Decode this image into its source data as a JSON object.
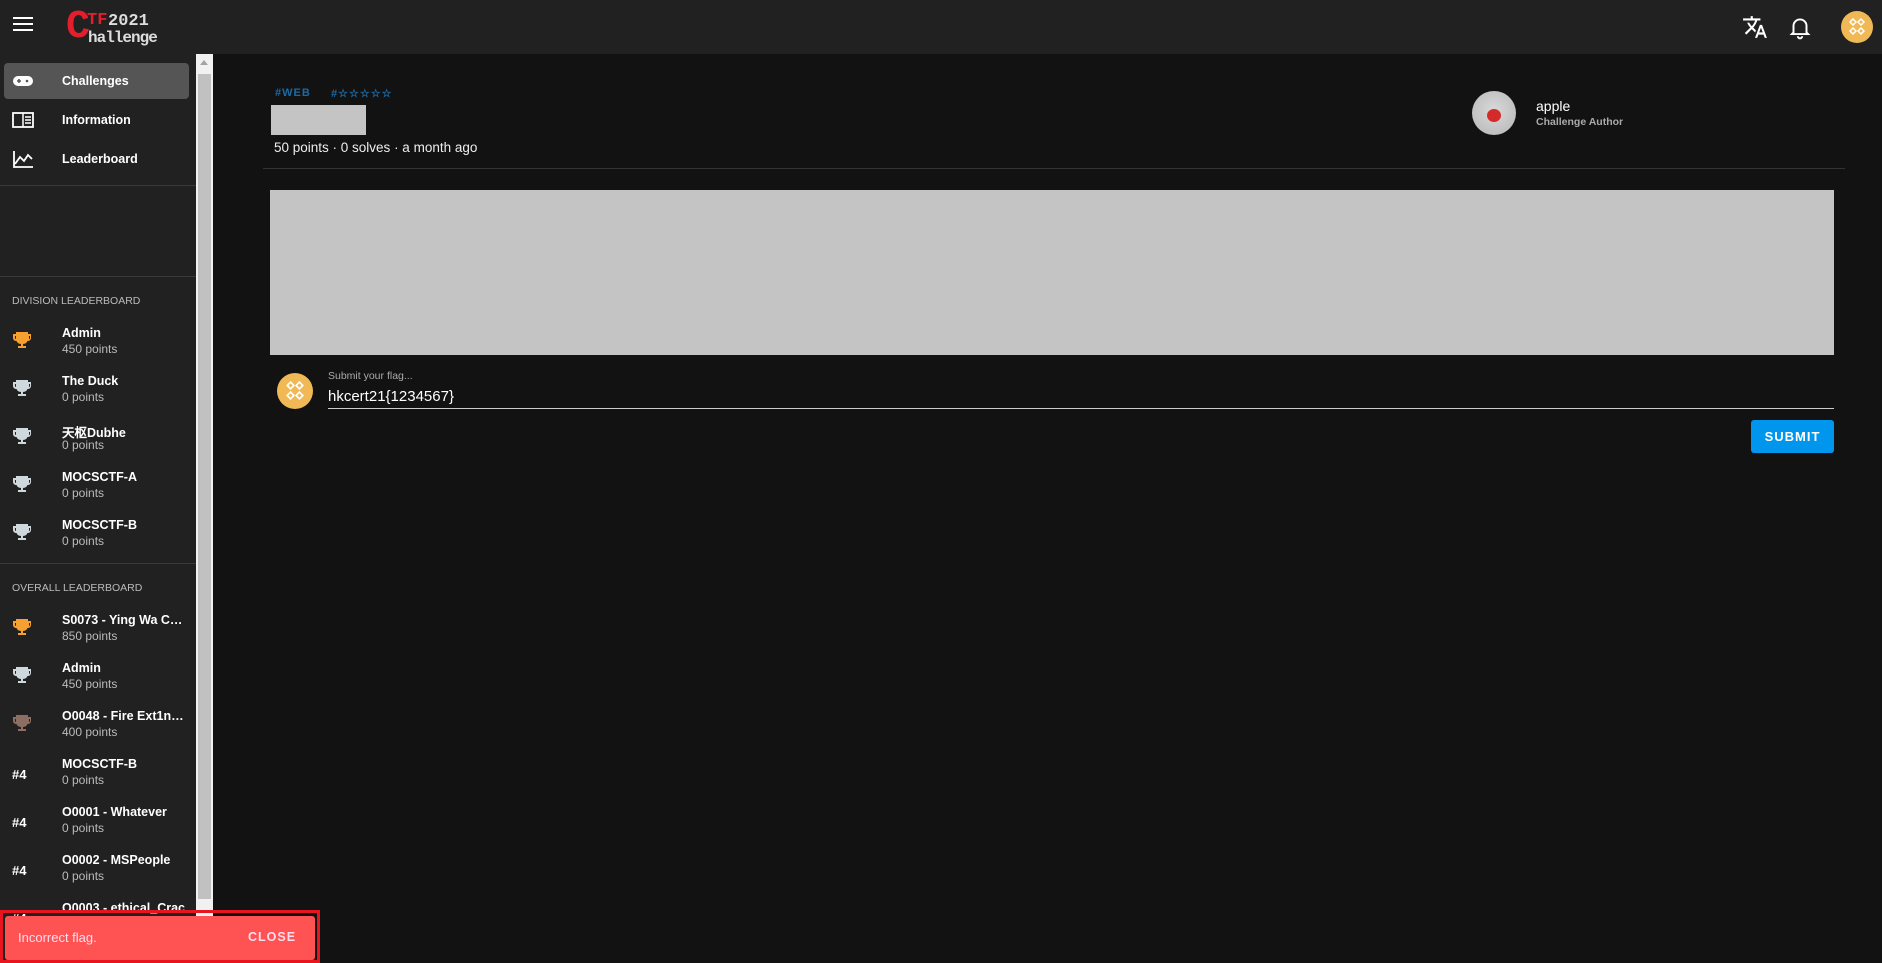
{
  "header": {
    "logo_text": "CTF 2021 Challenge",
    "icons": [
      "menu-icon",
      "translate-icon",
      "bell-icon",
      "user-avatar"
    ]
  },
  "sidebar": {
    "nav": [
      {
        "label": "Challenges",
        "icon": "gamepad-icon",
        "active": true
      },
      {
        "label": "Information",
        "icon": "book-icon"
      },
      {
        "label": "Leaderboard",
        "icon": "chart-icon"
      }
    ],
    "division_title": "DIVISION LEADERBOARD",
    "division": [
      {
        "name": "Admin",
        "points": "450 points",
        "trophy": "gold"
      },
      {
        "name": "The Duck",
        "points": "0 points",
        "trophy": "silver"
      },
      {
        "name": "天枢Dubhe",
        "points": "0 points",
        "trophy": "silver"
      },
      {
        "name": "MOCSCTF-A",
        "points": "0 points",
        "trophy": "silver"
      },
      {
        "name": "MOCSCTF-B",
        "points": "0 points",
        "trophy": "silver"
      }
    ],
    "overall_title": "OVERALL LEADERBOARD",
    "overall": [
      {
        "name": "S0073 - Ying Wa Coll...",
        "points": "850 points",
        "trophy": "gold"
      },
      {
        "name": "Admin",
        "points": "450 points",
        "trophy": "silver"
      },
      {
        "name": "O0048 - Fire Ext1ngu...",
        "points": "400 points",
        "trophy": "bronze"
      },
      {
        "name": "MOCSCTF-B",
        "points": "0 points",
        "rank": "#4"
      },
      {
        "name": "O0001 - Whatever",
        "points": "0 points",
        "rank": "#4"
      },
      {
        "name": "O0002 - MSPeople",
        "points": "0 points",
        "rank": "#4"
      },
      {
        "name": "O0003 - ethical_Crac",
        "points": "",
        "rank": "#4"
      }
    ]
  },
  "challenge": {
    "tags": [
      "#WEB",
      "#☆☆☆☆☆"
    ],
    "meta": "50 points · 0 solves · a month ago",
    "author": {
      "name": "apple",
      "role": "Challenge Author"
    }
  },
  "flag": {
    "label": "Submit your flag...",
    "value": "hkcert21{1234567}",
    "submit_label": "SUBMIT"
  },
  "snackbar": {
    "message": "Incorrect flag.",
    "close_label": "CLOSE"
  },
  "colors": {
    "accent": "#0096ee",
    "gold": "#f5a030",
    "silver": "#cfd8dc",
    "bronze": "#8d6e63",
    "error": "#ff5252"
  }
}
